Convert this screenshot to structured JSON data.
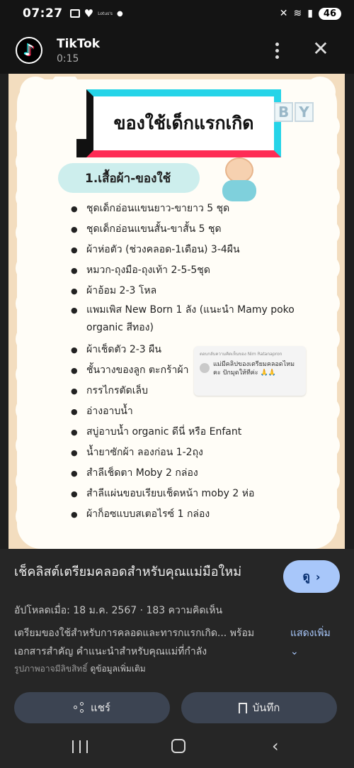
{
  "status": {
    "time": "07:27",
    "battery": "46",
    "carrier_label": "Lotus's"
  },
  "header": {
    "app_name": "TikTok",
    "duration": "0:15"
  },
  "media": {
    "title": "ของใช้เด็กแรกเกิด",
    "baby_letters": [
      "B",
      "Y"
    ],
    "section": "1.เสื้อผ้า-ของใช้",
    "items": [
      "ชุดเด็กอ่อนแขนยาว-ขายาว 5 ชุด",
      "ชุดเด็กอ่อนแขนสั้น-ขาสั้น 5 ชุด",
      "ผ้าห่อตัว (ช่วงคลอด-1เดือน) 3-4ผืน",
      "หมวก-ถุงมือ-ถุงเท้า 2-5-5ชุด",
      "ผ้าอ้อม 2-3 โหล",
      "แพมเพิส New Born 1 ลัง (แนะนำ Mamy poko organic สีทอง)",
      "ผ้าเช็ดตัว 2-3 ผืน",
      "ชั้นวางของลูก ตะกร้าผ้า",
      "กรรไกรตัดเล็บ",
      "อ่างอาบน้ำ",
      "สบู่อาบน้ำ organic ดีนี่ หรือ Enfant",
      "น้ำยาซักผ้า ลองก่อน 1-2ถุง",
      "สำลีเช็ดตา Moby 2 กล่อง",
      "สำลีแผ่นขอบเรียบเช็ดหน้า moby 2 ห่อ",
      "ผ้าก็อซแบบสเตอไรซ์ 1 กล่อง"
    ],
    "comment": {
      "header": "ตอบกลับความคิดเห็นของ Nim Ratanapron",
      "body": "แม่มีคลิปของเตรียมคลอดไหมคะ ปักมุดให้ทีค่ะ 🙏🙏"
    }
  },
  "info": {
    "title": "เช็คลิสต์เตรียมคลอดสำหรับคุณแม่มือใหม่",
    "view_label": "ดู",
    "meta": "อัปโหลดเมื่อ: 18 ม.ค. 2567 · 183 ความคิดเห็น",
    "description": "เตรียมของใช้สำหรับการคลอดและทารกแรกเกิด... พร้อมเอกสารสำคัญ คำแนะนำสำหรับคุณแม่ที่กำลัง",
    "show_more": "แสดงเพิ่ม",
    "copyright": "รูปภาพอาจมีลิขสิทธิ์",
    "details_link": "ดูข้อมูลเพิ่มเติม",
    "share_label": "แชร์",
    "save_label": "บันทึก"
  },
  "colors": {
    "accent_blue": "#a8c7fa",
    "tiktok_cyan": "#25d4e8",
    "tiktok_red": "#fe2c55"
  }
}
